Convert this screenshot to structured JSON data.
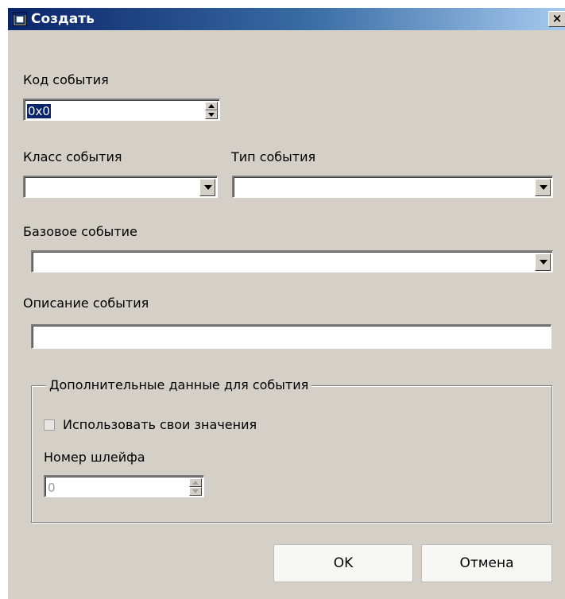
{
  "window": {
    "title": "Создать",
    "close_glyph": "×"
  },
  "fields": {
    "event_code": {
      "label": "Код события",
      "value": "0x0"
    },
    "event_class": {
      "label": "Класс события",
      "value": ""
    },
    "event_type": {
      "label": "Тип события",
      "value": ""
    },
    "base_event": {
      "label": "Базовое событие",
      "value": ""
    },
    "description": {
      "label": "Описание события",
      "value": ""
    }
  },
  "extra_group": {
    "title": "Дополнительные данные для события",
    "use_own_values": {
      "label": "Использовать свои значения",
      "checked": false
    },
    "loop_number": {
      "label": "Номер шлейфа",
      "value": "0",
      "disabled": true
    }
  },
  "buttons": {
    "ok": "OK",
    "cancel": "Отмена"
  },
  "icons": {
    "title": "window-app-icon",
    "close": "close-icon"
  }
}
